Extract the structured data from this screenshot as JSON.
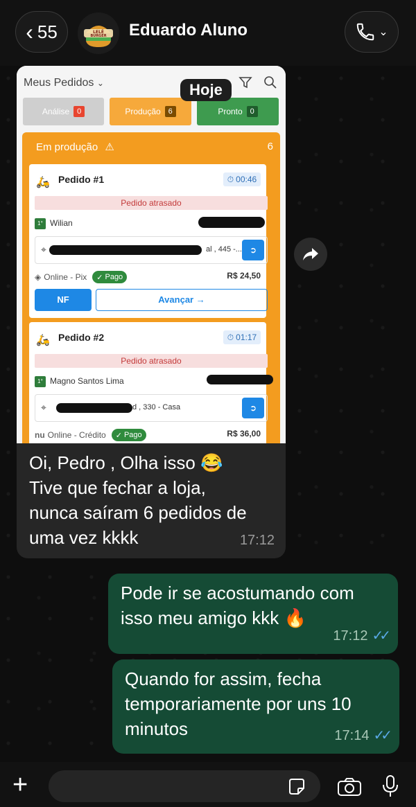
{
  "header": {
    "back_count": "55",
    "contact_name": "Eduardo Aluno",
    "avatar_text_top": "LELÊ",
    "avatar_text_bottom": "BURGER"
  },
  "screenshot": {
    "title": "Meus Pedidos",
    "date_chip": "Hoje",
    "tabs": [
      {
        "label": "Análise",
        "count": "0"
      },
      {
        "label": "Produção",
        "count": "6"
      },
      {
        "label": "Pronto",
        "count": "0"
      }
    ],
    "section": {
      "label": "Em produção",
      "count": "6"
    },
    "orders": [
      {
        "title": "Pedido #1",
        "time": "00:46",
        "late": "Pedido atrasado",
        "badge": "1°",
        "name": "Wilian",
        "address": "al , 445 -...",
        "payment": "Online - Pix",
        "status": "Pago",
        "price": "R$ 24,50",
        "nf": "NF",
        "advance": "Avançar →"
      },
      {
        "title": "Pedido #2",
        "time": "01:17",
        "late": "Pedido atrasado",
        "badge": "1°",
        "name": "Magno Santos Lima",
        "address": "d , 330 - Casa",
        "payment": "Online - Crédito",
        "payment_brand": "nu",
        "status": "Pago",
        "price": "R$ 36,00"
      }
    ]
  },
  "messages": [
    {
      "dir": "in",
      "text": "Oi, Pedro , Olha isso 😂 Tive que fechar a loja, nunca saíram 6 pedidos de uma vez kkkk",
      "time": "17:12"
    },
    {
      "dir": "out",
      "text": "Pode ir se acostumando com isso meu amigo kkk 🔥",
      "time": "17:12"
    },
    {
      "dir": "out",
      "text": "Quando for assim, fecha temporariamente por uns 10 minutos",
      "time": "17:14"
    }
  ],
  "input": {
    "placeholder": ""
  },
  "colors": {
    "incoming_bubble": "#262626",
    "outgoing_bubble": "#154b35",
    "read_ticks": "#5aa9e6",
    "prod_orange": "#f39c1f"
  }
}
